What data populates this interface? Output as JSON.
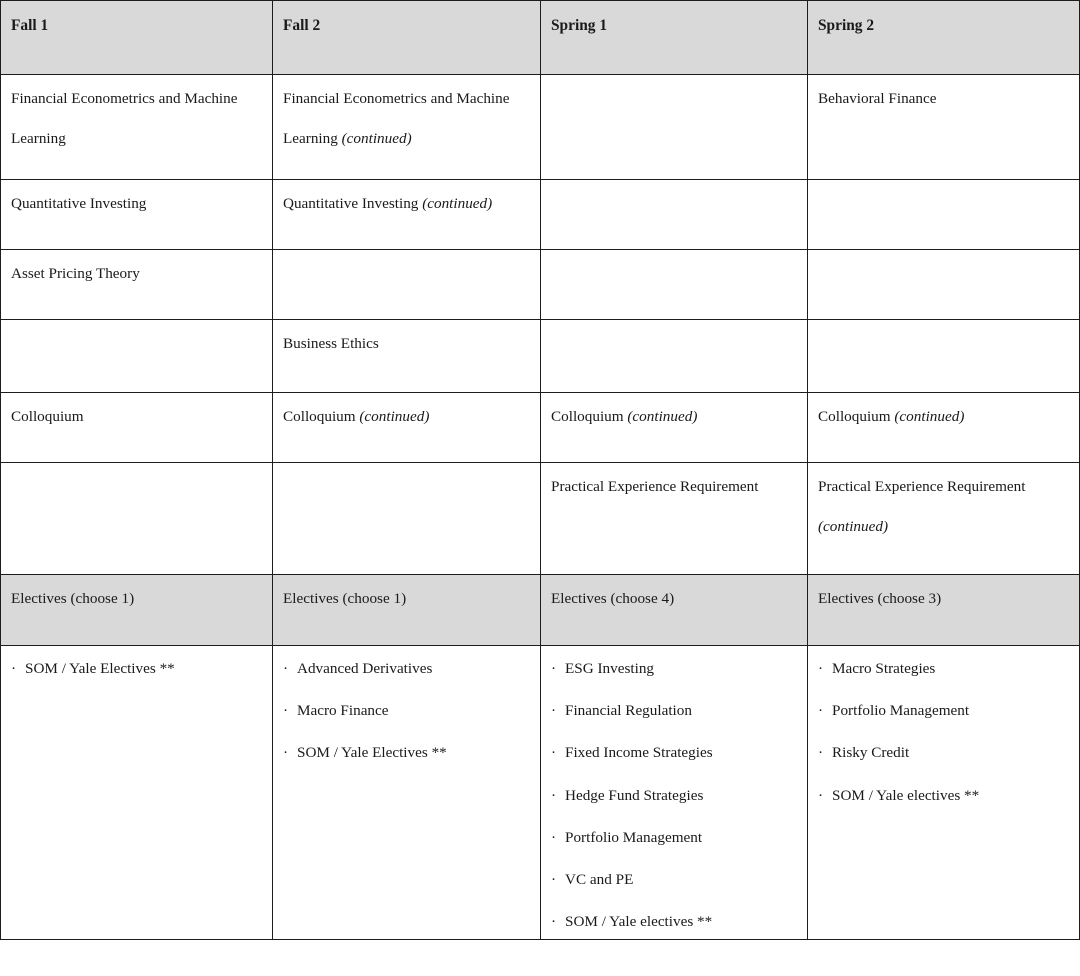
{
  "table": {
    "headers": [
      "Fall 1",
      "Fall 2",
      "Spring 1",
      "Spring 2"
    ],
    "shade_color": "#d9d9d9",
    "border_color": "#1d1d1d",
    "rows": [
      {
        "name": "financial-econometrics",
        "cells": [
          {
            "lines": [
              {
                "text": "Financial Econometrics and Machine"
              },
              {
                "text": "Learning"
              }
            ]
          },
          {
            "lines": [
              {
                "text": "Financial Econometrics and Machine"
              },
              {
                "text": "Learning",
                "note": "(continued)"
              }
            ]
          },
          {
            "lines": []
          },
          {
            "lines": [
              {
                "text": "Behavioral Finance"
              }
            ]
          }
        ]
      },
      {
        "name": "quantitative-investing",
        "cells": [
          {
            "lines": [
              {
                "text": "Quantitative Investing"
              }
            ]
          },
          {
            "lines": [
              {
                "text": "Quantitative Investing",
                "note": "(continued)"
              }
            ]
          },
          {
            "lines": []
          },
          {
            "lines": []
          }
        ]
      },
      {
        "name": "asset-pricing-theory",
        "cells": [
          {
            "lines": [
              {
                "text": "Asset Pricing Theory"
              }
            ]
          },
          {
            "lines": []
          },
          {
            "lines": []
          },
          {
            "lines": []
          }
        ]
      },
      {
        "name": "business-ethics",
        "cells": [
          {
            "lines": []
          },
          {
            "lines": [
              {
                "text": "Business Ethics"
              }
            ]
          },
          {
            "lines": []
          },
          {
            "lines": []
          }
        ]
      },
      {
        "name": "colloquium",
        "cells": [
          {
            "lines": [
              {
                "text": "Colloquium"
              }
            ]
          },
          {
            "lines": [
              {
                "text": "Colloquium",
                "note": "(continued)"
              }
            ]
          },
          {
            "lines": [
              {
                "text": "Colloquium",
                "note": "(continued)"
              }
            ]
          },
          {
            "lines": [
              {
                "text": "Colloquium",
                "note": "(continued)"
              }
            ]
          }
        ]
      },
      {
        "name": "practical-experience",
        "cells": [
          {
            "lines": []
          },
          {
            "lines": []
          },
          {
            "lines": [
              {
                "text": "Practical Experience Requirement"
              }
            ]
          },
          {
            "lines": [
              {
                "text": "Practical Experience Requirement"
              },
              {
                "text": "",
                "note": "(continued)"
              }
            ]
          }
        ]
      }
    ],
    "electives_header": [
      "Electives (choose 1)",
      "Electives (choose 1)",
      "Electives (choose 4)",
      "Electives (choose 3)"
    ],
    "electives_lists": [
      {
        "column": "Fall 1",
        "bullet": "·",
        "items": [
          "SOM / Yale Electives **"
        ]
      },
      {
        "column": "Fall 2",
        "bullet": "·",
        "items": [
          "Advanced Derivatives",
          "Macro Finance",
          "SOM / Yale Electives **"
        ]
      },
      {
        "column": "Spring 1",
        "bullet": "·",
        "items": [
          "ESG Investing",
          "Financial Regulation",
          "Fixed Income Strategies",
          "Hedge Fund Strategies",
          "Portfolio Management",
          "VC and PE",
          "SOM / Yale electives **"
        ]
      },
      {
        "column": "Spring 2",
        "bullet": "·",
        "items": [
          "Macro Strategies",
          "Portfolio Management",
          "Risky Credit",
          "SOM / Yale electives **"
        ]
      }
    ]
  }
}
